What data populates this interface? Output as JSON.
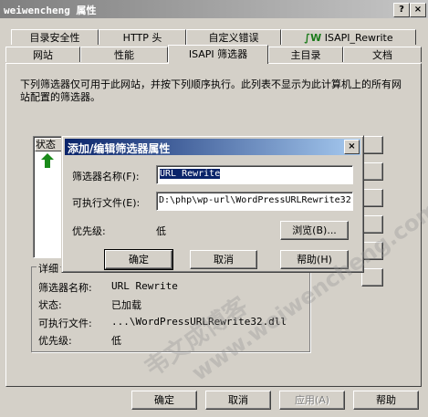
{
  "window": {
    "title": "weiwencheng 属性",
    "help_glyph": "?",
    "close_glyph": "×"
  },
  "tabs_row1": [
    "目录安全性",
    "HTTP 头",
    "自定义错误",
    "ISAPI_Rewrite"
  ],
  "tabs_row2": [
    "网站",
    "性能",
    "ISAPI 筛选器",
    "主目录",
    "文档"
  ],
  "panel": {
    "description": "下列筛选器仅可用于此网站，并按下列顺序执行。此列表不显示为此计算机上的所有网站配置的筛选器。",
    "list_header": "状态",
    "details_title": "详细",
    "details": {
      "name_label": "筛选器名称:",
      "name_value": "URL Rewrite",
      "status_label": "状态:",
      "status_value": "已加载",
      "exe_label": "可执行文件:",
      "exe_value": "...\\WordPressURLRewrite32.dll",
      "priority_label": "优先级:",
      "priority_value": "低"
    }
  },
  "dialog": {
    "title": "添加/编辑筛选器属性",
    "name_label": "筛选器名称(F):",
    "name_value": "URL Rewrite",
    "exe_label": "可执行文件(E):",
    "exe_value": "D:\\php\\wp-url\\WordPressURLRewrite32",
    "priority_label": "优先级:",
    "priority_value": "低",
    "browse_label": "浏览(B)...",
    "ok_label": "确定",
    "cancel_label": "取消",
    "help_label": "帮助(H)"
  },
  "footer": {
    "ok_label": "确定",
    "cancel_label": "取消",
    "apply_label": "应用(A)",
    "help_label": "帮助"
  },
  "watermark": {
    "cn": "韦文成博客",
    "url": "www.weiwencheng.com"
  }
}
